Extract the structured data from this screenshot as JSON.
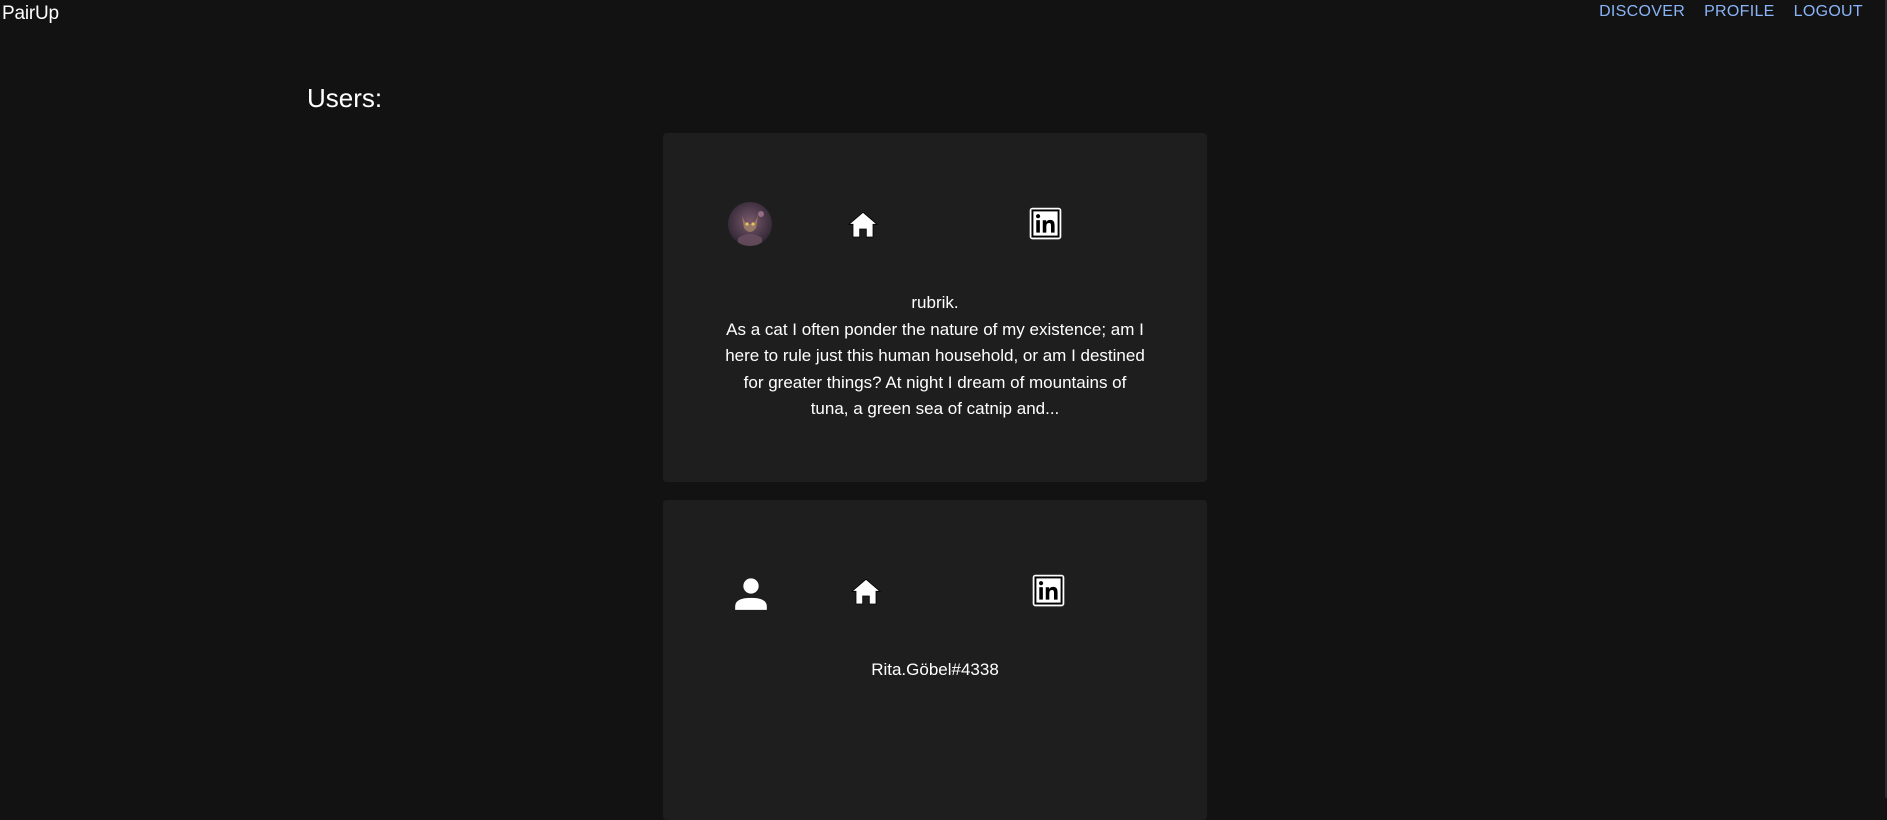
{
  "app": {
    "brand": "PairUp"
  },
  "nav": {
    "items": [
      {
        "label": "DISCOVER"
      },
      {
        "label": "PROFILE"
      },
      {
        "label": "LOGOUT"
      }
    ]
  },
  "page": {
    "title": "Users:"
  },
  "users": [
    {
      "name": "rubrik.",
      "bio": "As a cat I often ponder the nature of my existence; am I here to rule just this human household, or am I destined for greater things? At night I dream of mountains of tuna, a green sea of catnip and...",
      "avatar": "cat-photo",
      "icons": [
        "avatar",
        "home-icon",
        "linkedin-icon"
      ]
    },
    {
      "name": "Rita.Göbel#4338",
      "bio": "",
      "avatar": "person-icon",
      "icons": [
        "person-icon",
        "home-icon",
        "linkedin-icon"
      ]
    }
  ],
  "colors": {
    "background": "#121212",
    "card": "#1e1e1e",
    "nav_link": "#8ab4f8",
    "text": "#ffffff"
  }
}
